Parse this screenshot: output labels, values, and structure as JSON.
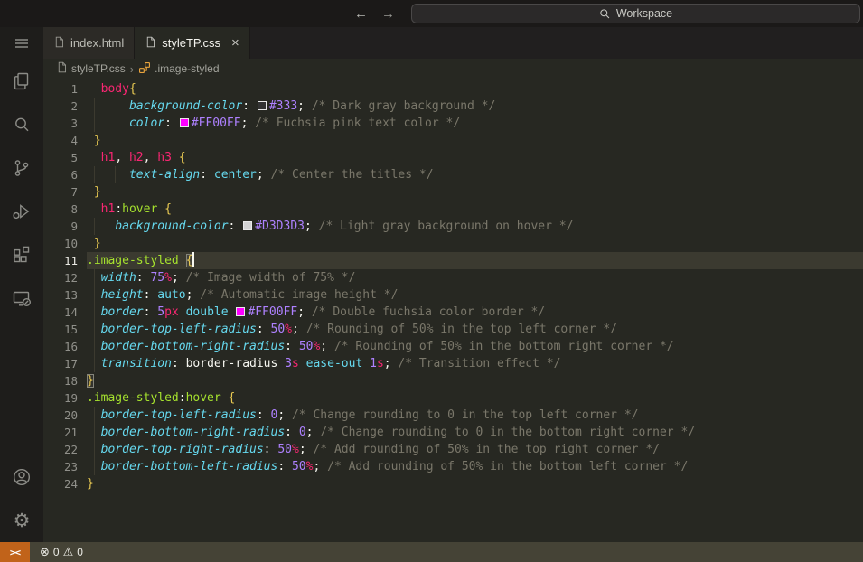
{
  "window": {
    "nav_back": "←",
    "nav_forward": "→",
    "command_center": {
      "label": "Workspace"
    }
  },
  "activity_bar": {
    "items": [
      {
        "name": "menu-icon"
      },
      {
        "name": "explorer-icon"
      },
      {
        "name": "search-icon"
      },
      {
        "name": "source-control-icon"
      },
      {
        "name": "run-debug-icon"
      },
      {
        "name": "extensions-icon"
      },
      {
        "name": "remote-explorer-icon"
      }
    ],
    "bottom": [
      {
        "name": "account-icon"
      },
      {
        "name": "settings-gear-icon"
      }
    ]
  },
  "tabs": [
    {
      "label": "index.html",
      "active": false,
      "close": false
    },
    {
      "label": "styleTP.css",
      "active": true,
      "close": true
    }
  ],
  "tab_close_glyph": "×",
  "breadcrumb": {
    "separator": "›",
    "items": [
      {
        "icon": "file-icon",
        "label": "styleTP.css"
      },
      {
        "icon": "symbol-class-icon",
        "label": ".image-styled"
      }
    ]
  },
  "editor": {
    "active_line": 11,
    "lines": [
      {
        "n": 1,
        "t": [
          [
            "p",
            "  "
          ],
          [
            "sel",
            "body"
          ],
          [
            "br",
            "{"
          ]
        ]
      },
      {
        "n": 2,
        "g": [
          1
        ],
        "t": [
          [
            "p",
            "      "
          ],
          [
            "prop",
            "background-color"
          ],
          [
            "pun",
            ":"
          ],
          [
            "p",
            " "
          ],
          [
            "sw",
            "#333"
          ],
          [
            "val",
            "#333"
          ],
          [
            "pun",
            ";"
          ],
          [
            "p",
            " "
          ],
          [
            "com",
            "/* Dark gray background */"
          ]
        ]
      },
      {
        "n": 3,
        "g": [
          1
        ],
        "t": [
          [
            "p",
            "      "
          ],
          [
            "prop",
            "color"
          ],
          [
            "pun",
            ":"
          ],
          [
            "p",
            " "
          ],
          [
            "sw",
            "#FF00FF"
          ],
          [
            "val",
            "#FF00FF"
          ],
          [
            "pun",
            ";"
          ],
          [
            "p",
            " "
          ],
          [
            "com",
            "/* Fuchsia pink text color */"
          ]
        ]
      },
      {
        "n": 4,
        "t": [
          [
            "p",
            " "
          ],
          [
            "br",
            "}"
          ]
        ]
      },
      {
        "n": 5,
        "t": [
          [
            "p",
            "  "
          ],
          [
            "sel",
            "h1"
          ],
          [
            "pun",
            ","
          ],
          [
            "p",
            " "
          ],
          [
            "sel",
            "h2"
          ],
          [
            "pun",
            ","
          ],
          [
            "p",
            " "
          ],
          [
            "sel",
            "h3"
          ],
          [
            "p",
            " "
          ],
          [
            "br",
            "{"
          ]
        ]
      },
      {
        "n": 6,
        "g": [
          1,
          4
        ],
        "t": [
          [
            "p",
            "      "
          ],
          [
            "prop",
            "text-align"
          ],
          [
            "pun",
            ":"
          ],
          [
            "p",
            " "
          ],
          [
            "kw",
            "center"
          ],
          [
            "pun",
            ";"
          ],
          [
            "p",
            " "
          ],
          [
            "com",
            "/* Center the titles */"
          ]
        ]
      },
      {
        "n": 7,
        "t": [
          [
            "p",
            " "
          ],
          [
            "br",
            "}"
          ]
        ]
      },
      {
        "n": 8,
        "t": [
          [
            "p",
            "  "
          ],
          [
            "sel",
            "h1"
          ],
          [
            "pun",
            ":"
          ],
          [
            "cls",
            "hover"
          ],
          [
            "p",
            " "
          ],
          [
            "br",
            "{"
          ]
        ]
      },
      {
        "n": 9,
        "g": [
          1
        ],
        "t": [
          [
            "p",
            "    "
          ],
          [
            "prop",
            "background-color"
          ],
          [
            "pun",
            ":"
          ],
          [
            "p",
            " "
          ],
          [
            "sw",
            "#D3D3D3"
          ],
          [
            "val",
            "#D3D3D3"
          ],
          [
            "pun",
            ";"
          ],
          [
            "p",
            " "
          ],
          [
            "com",
            "/* Light gray background on hover */"
          ]
        ]
      },
      {
        "n": 10,
        "t": [
          [
            "p",
            " "
          ],
          [
            "br",
            "}"
          ]
        ]
      },
      {
        "n": 11,
        "a": true,
        "caret": true,
        "t": [
          [
            "cls",
            ".image-styled"
          ],
          [
            "p",
            " "
          ],
          [
            "brm",
            "{"
          ]
        ]
      },
      {
        "n": 12,
        "g": [
          1
        ],
        "t": [
          [
            "p",
            "  "
          ],
          [
            "prop",
            "width"
          ],
          [
            "pun",
            ":"
          ],
          [
            "p",
            " "
          ],
          [
            "val",
            "75"
          ],
          [
            "unit",
            "%"
          ],
          [
            "pun",
            ";"
          ],
          [
            "p",
            " "
          ],
          [
            "com",
            "/* Image width of 75% */"
          ]
        ]
      },
      {
        "n": 13,
        "g": [
          1
        ],
        "t": [
          [
            "p",
            "  "
          ],
          [
            "prop",
            "height"
          ],
          [
            "pun",
            ":"
          ],
          [
            "p",
            " "
          ],
          [
            "kw",
            "auto"
          ],
          [
            "pun",
            ";"
          ],
          [
            "p",
            " "
          ],
          [
            "com",
            "/* Automatic image height */"
          ]
        ]
      },
      {
        "n": 14,
        "g": [
          1
        ],
        "t": [
          [
            "p",
            "  "
          ],
          [
            "prop",
            "border"
          ],
          [
            "pun",
            ":"
          ],
          [
            "p",
            " "
          ],
          [
            "val",
            "5"
          ],
          [
            "unit",
            "px"
          ],
          [
            "p",
            " "
          ],
          [
            "kw",
            "double"
          ],
          [
            "p",
            " "
          ],
          [
            "sw",
            "#FF00FF"
          ],
          [
            "val",
            "#FF00FF"
          ],
          [
            "pun",
            ";"
          ],
          [
            "p",
            " "
          ],
          [
            "com",
            "/* Double fuchsia color border */"
          ]
        ]
      },
      {
        "n": 15,
        "g": [
          1
        ],
        "t": [
          [
            "p",
            "  "
          ],
          [
            "prop",
            "border-top-left-radius"
          ],
          [
            "pun",
            ":"
          ],
          [
            "p",
            " "
          ],
          [
            "val",
            "50"
          ],
          [
            "unit",
            "%"
          ],
          [
            "pun",
            ";"
          ],
          [
            "p",
            " "
          ],
          [
            "com",
            "/* Rounding of 50% in the top left corner */"
          ]
        ]
      },
      {
        "n": 16,
        "g": [
          1
        ],
        "t": [
          [
            "p",
            "  "
          ],
          [
            "prop",
            "border-bottom-right-radius"
          ],
          [
            "pun",
            ":"
          ],
          [
            "p",
            " "
          ],
          [
            "val",
            "50"
          ],
          [
            "unit",
            "%"
          ],
          [
            "pun",
            ";"
          ],
          [
            "p",
            " "
          ],
          [
            "com",
            "/* Rounding of 50% in the bottom right corner */"
          ]
        ]
      },
      {
        "n": 17,
        "g": [
          1
        ],
        "t": [
          [
            "p",
            "  "
          ],
          [
            "prop",
            "transition"
          ],
          [
            "pun",
            ":"
          ],
          [
            "p",
            " "
          ],
          [
            "pln",
            "border-radius"
          ],
          [
            "p",
            " "
          ],
          [
            "val",
            "3"
          ],
          [
            "unit",
            "s"
          ],
          [
            "p",
            " "
          ],
          [
            "kw",
            "ease-out"
          ],
          [
            "p",
            " "
          ],
          [
            "val",
            "1"
          ],
          [
            "unit",
            "s"
          ],
          [
            "pun",
            ";"
          ],
          [
            "p",
            " "
          ],
          [
            "com",
            "/* Transition effect */"
          ]
        ]
      },
      {
        "n": 18,
        "t": [
          [
            "brm",
            "}"
          ]
        ]
      },
      {
        "n": 19,
        "t": [
          [
            "cls",
            ".image-styled"
          ],
          [
            "pun",
            ":"
          ],
          [
            "cls",
            "hover"
          ],
          [
            "p",
            " "
          ],
          [
            "br",
            "{"
          ]
        ]
      },
      {
        "n": 20,
        "g": [
          1
        ],
        "t": [
          [
            "p",
            "  "
          ],
          [
            "prop",
            "border-top-left-radius"
          ],
          [
            "pun",
            ":"
          ],
          [
            "p",
            " "
          ],
          [
            "val",
            "0"
          ],
          [
            "pun",
            ";"
          ],
          [
            "p",
            " "
          ],
          [
            "com",
            "/* Change rounding to 0 in the top left corner */"
          ]
        ]
      },
      {
        "n": 21,
        "g": [
          1
        ],
        "t": [
          [
            "p",
            "  "
          ],
          [
            "prop",
            "border-bottom-right-radius"
          ],
          [
            "pun",
            ":"
          ],
          [
            "p",
            " "
          ],
          [
            "val",
            "0"
          ],
          [
            "pun",
            ";"
          ],
          [
            "p",
            " "
          ],
          [
            "com",
            "/* Change rounding to 0 in the bottom right corner */"
          ]
        ]
      },
      {
        "n": 22,
        "g": [
          1
        ],
        "t": [
          [
            "p",
            "  "
          ],
          [
            "prop",
            "border-top-right-radius"
          ],
          [
            "pun",
            ":"
          ],
          [
            "p",
            " "
          ],
          [
            "val",
            "50"
          ],
          [
            "unit",
            "%"
          ],
          [
            "pun",
            ";"
          ],
          [
            "p",
            " "
          ],
          [
            "com",
            "/* Add rounding of 50% in the top right corner */"
          ]
        ]
      },
      {
        "n": 23,
        "g": [
          1
        ],
        "t": [
          [
            "p",
            "  "
          ],
          [
            "prop",
            "border-bottom-left-radius"
          ],
          [
            "pun",
            ":"
          ],
          [
            "p",
            " "
          ],
          [
            "val",
            "50"
          ],
          [
            "unit",
            "%"
          ],
          [
            "pun",
            ";"
          ],
          [
            "p",
            " "
          ],
          [
            "com",
            "/* Add rounding of 50% in the bottom left corner */"
          ]
        ]
      },
      {
        "n": 24,
        "t": [
          [
            "br",
            "}"
          ]
        ]
      }
    ]
  },
  "status_bar": {
    "remote": {
      "label": "><"
    },
    "problems": {
      "error_glyph": "⊗",
      "error_count": "0",
      "warning_glyph": "⚠",
      "warning_count": "0"
    }
  },
  "theme": {
    "editor_bg": "#272822",
    "titlebar_bg": "#1B1918",
    "activitybar_bg": "#1E1D1B",
    "tabbar_bg": "#211F1F",
    "tab_inactive_bg": "#2C2A26",
    "line_highlight": "#3B3A30",
    "status_bg": "#454336",
    "remote_bg": "#C1631A",
    "selector": "#F92672",
    "class_name": "#A6E22E",
    "property": "#66D9EF",
    "keyword": "#66D9EF",
    "number": "#AE81FF",
    "unit": "#F92672",
    "punctuation": "#F8F8F2",
    "brace": "#E8C952",
    "comment": "#7A776A",
    "breadcrumb_icon": "#E8A33D"
  }
}
